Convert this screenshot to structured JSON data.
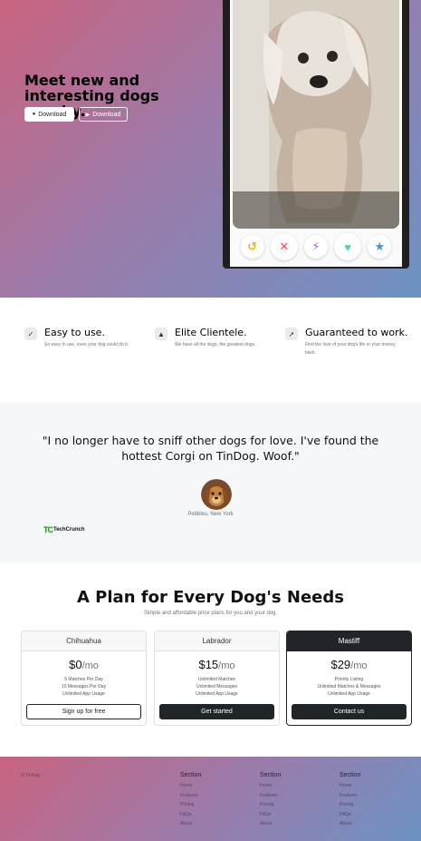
{
  "hero": {
    "title": "Meet new and interesting dogs nearby.",
    "download_apple_label": "Download",
    "download_play_label": "Download",
    "action_icons": [
      "undo-icon",
      "cross-icon",
      "bolt-icon",
      "heart-icon",
      "star-icon"
    ]
  },
  "features": [
    {
      "icon": "check-circle-icon",
      "title": "Easy to use.",
      "text": "So easy to use, even your dog could do it."
    },
    {
      "icon": "graduation-cap-icon",
      "title": "Elite Clientele.",
      "text": "We have all the dogs, the greatest dogs."
    },
    {
      "icon": "heart-arrow-icon",
      "title": "Guaranteed to work.",
      "text": "Find the love of your dog's life or your money back."
    }
  ],
  "testimonial": {
    "quote": "\"I no longer have to sniff other dogs for love. I've found the hottest Corgi on TinDog. Woof.\"",
    "author": "Pebbles, New York",
    "press_tc": "TC",
    "press_name": "TechCrunch"
  },
  "pricing": {
    "title": "A Plan for Every Dog's Needs",
    "subtitle": "Simple and affordable price plans for you and your dog.",
    "unit": "/mo",
    "plans": [
      {
        "name": "Chihuahua",
        "price": "$0",
        "features": [
          "5 Matches Per Day",
          "10 Messages Per Day",
          "Unlimited App Usage"
        ],
        "button": "Sign up for free"
      },
      {
        "name": "Labrador",
        "price": "$15",
        "features": [
          "Unlimited Matches",
          "Unlimited Messages",
          "Unlimited App Usage"
        ],
        "button": "Get started"
      },
      {
        "name": "Mastiff",
        "price": "$29",
        "features": [
          "Priority Listing",
          "Unlimited Matches & Messages",
          "Unlimited App Usage"
        ],
        "button": "Contact us"
      }
    ]
  },
  "footer": {
    "copyright": "© TinDog",
    "columns": [
      {
        "title": "Section",
        "links": [
          "Home",
          "Features",
          "Pricing",
          "FAQs",
          "About"
        ]
      },
      {
        "title": "Section",
        "links": [
          "Home",
          "Features",
          "Pricing",
          "FAQs",
          "About"
        ]
      },
      {
        "title": "Section",
        "links": [
          "Home",
          "Features",
          "Pricing",
          "FAQs",
          "About"
        ]
      }
    ]
  },
  "colors": {
    "gradient_start": "#c9637f",
    "gradient_end": "#6c93c4",
    "dark": "#212529",
    "tc_green": "#0a9e01"
  }
}
